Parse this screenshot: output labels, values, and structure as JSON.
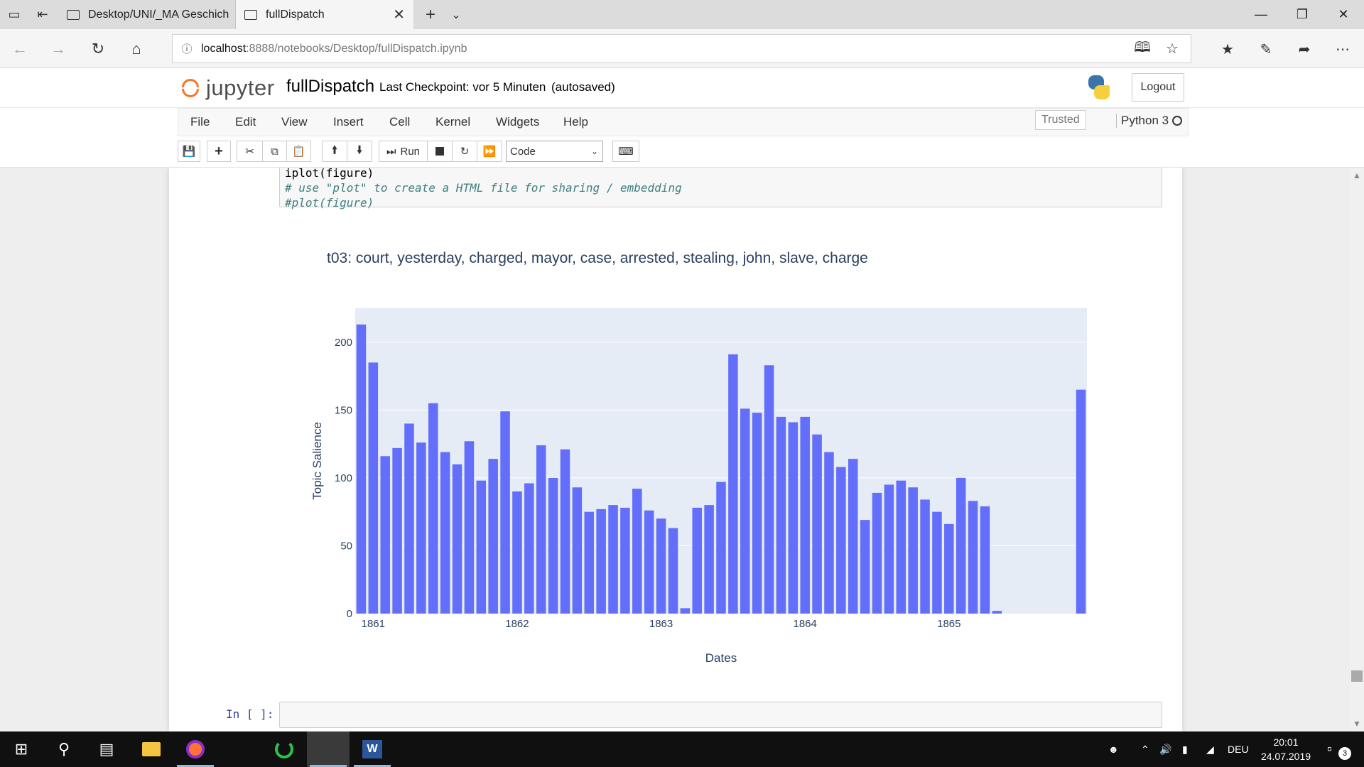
{
  "browser": {
    "tabs": [
      {
        "title": "Desktop/UNI/_MA Geschich"
      },
      {
        "title": "fullDispatch"
      }
    ],
    "url_host": "localhost",
    "url_path": ":8888/notebooks/Desktop/fullDispatch.ipynb"
  },
  "jupyter": {
    "logo_text": "jupyter",
    "notebook_name": "fullDispatch",
    "checkpoint": "Last Checkpoint: vor 5 Minuten",
    "autosave": "(autosaved)",
    "logout_label": "Logout",
    "menu": [
      "File",
      "Edit",
      "View",
      "Insert",
      "Cell",
      "Kernel",
      "Widgets",
      "Help"
    ],
    "trusted_label": "Trusted",
    "kernel_label": "Python 3",
    "run_label": "Run",
    "cell_type": "Code"
  },
  "code_cell": {
    "lines": [
      "iplot(figure)",
      "# use \"plot\" to create a HTML file for sharing / embedding",
      "#plot(figure)"
    ]
  },
  "input_prompt": "In [ ]:",
  "chart_data": {
    "type": "bar",
    "title": "t03: court, yesterday, charged, mayor, case, arrested, stealing, john, slave, charge",
    "xlabel": "Dates",
    "ylabel": "Topic Salience",
    "ylim": [
      0,
      225
    ],
    "yticks": [
      0,
      50,
      100,
      150,
      200
    ],
    "xticks": [
      "1861",
      "1862",
      "1863",
      "1864",
      "1865"
    ],
    "grid": true,
    "bar_color": "#636efa",
    "plot_bg": "#e5ecf6",
    "x_unit": "month",
    "x": [
      "1860-12",
      "1861-01",
      "1861-02",
      "1861-03",
      "1861-04",
      "1861-05",
      "1861-06",
      "1861-07",
      "1861-08",
      "1861-09",
      "1861-10",
      "1861-11",
      "1861-12",
      "1862-01",
      "1862-02",
      "1862-03",
      "1862-04",
      "1862-05",
      "1862-06",
      "1862-07",
      "1862-08",
      "1862-09",
      "1862-10",
      "1862-11",
      "1862-12",
      "1863-01",
      "1863-02",
      "1863-03",
      "1863-04",
      "1863-05",
      "1863-06",
      "1863-07",
      "1863-08",
      "1863-09",
      "1863-10",
      "1863-11",
      "1863-12",
      "1864-01",
      "1864-02",
      "1864-03",
      "1864-04",
      "1864-05",
      "1864-06",
      "1864-07",
      "1864-08",
      "1864-09",
      "1864-10",
      "1864-11",
      "1864-12",
      "1865-01",
      "1865-02",
      "1865-03",
      "1865-04",
      "1865-05",
      "1865-12"
    ],
    "values": [
      213,
      185,
      116,
      122,
      140,
      126,
      155,
      119,
      110,
      127,
      98,
      114,
      149,
      90,
      96,
      124,
      100,
      121,
      93,
      75,
      77,
      80,
      78,
      92,
      76,
      70,
      63,
      4,
      78,
      80,
      97,
      191,
      151,
      148,
      183,
      145,
      141,
      145,
      132,
      119,
      108,
      114,
      69,
      89,
      95,
      98,
      93,
      84,
      75,
      66,
      100,
      83,
      79,
      2,
      165
    ]
  },
  "taskbar": {
    "lang": "DEU",
    "time": "20:01",
    "date": "24.07.2019",
    "notification_count": "3"
  }
}
